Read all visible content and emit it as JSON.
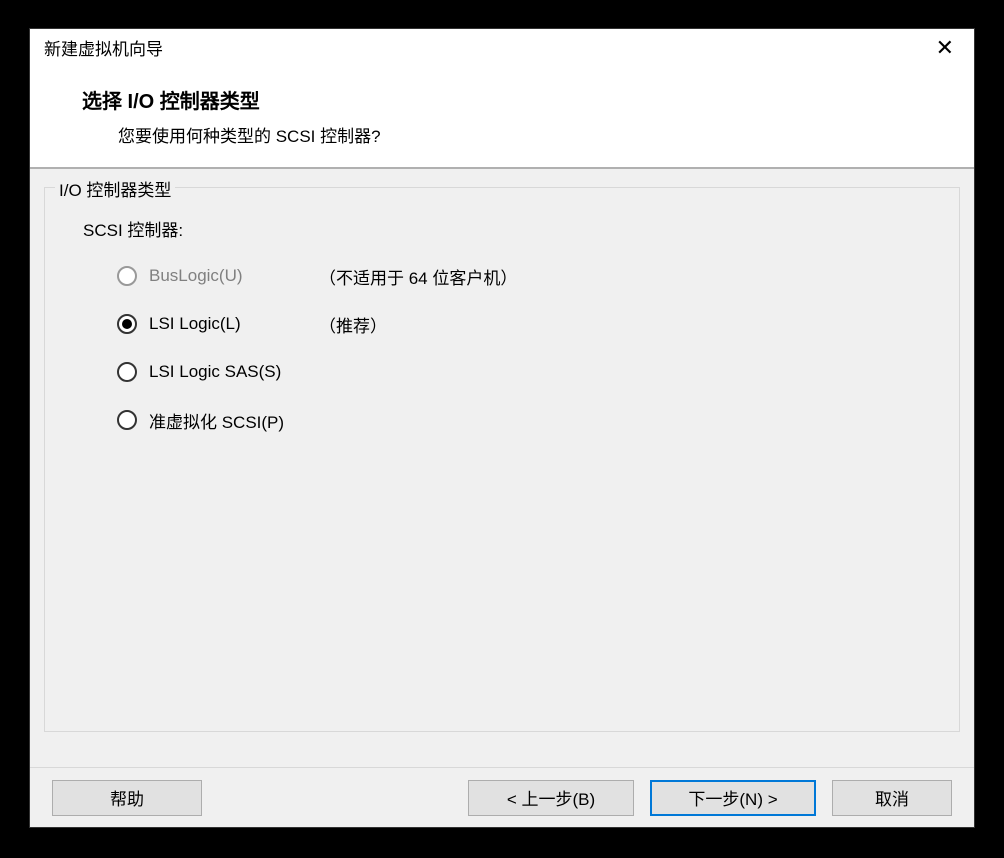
{
  "dialog": {
    "title": "新建虚拟机向导"
  },
  "header": {
    "title": "选择 I/O 控制器类型",
    "subtitle": "您要使用何种类型的 SCSI 控制器?"
  },
  "fieldset": {
    "legend": "I/O 控制器类型",
    "scsi_label": "SCSI 控制器:"
  },
  "options": [
    {
      "label": "BusLogic(U)",
      "note": "（不适用于 64 位客户机）",
      "disabled": true,
      "checked": false
    },
    {
      "label": "LSI Logic(L)",
      "note": "（推荐）",
      "disabled": false,
      "checked": true
    },
    {
      "label": "LSI Logic SAS(S)",
      "note": "",
      "disabled": false,
      "checked": false
    },
    {
      "label": "准虚拟化 SCSI(P)",
      "note": "",
      "disabled": false,
      "checked": false
    }
  ],
  "footer": {
    "help": "帮助",
    "back": "< 上一步(B)",
    "next": "下一步(N) >",
    "cancel": "取消"
  }
}
